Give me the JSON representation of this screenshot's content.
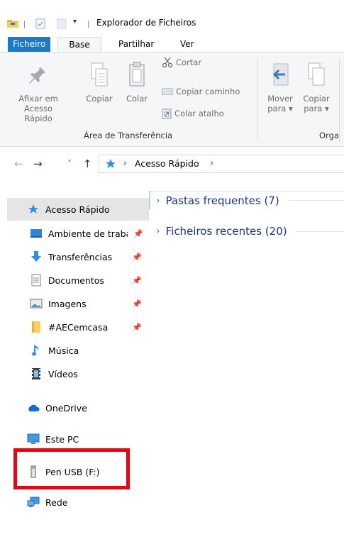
{
  "titlebar": {
    "title": "Explorador de Ficheiros",
    "dropdown_glyph": "▾"
  },
  "tabs": [
    {
      "label": "Ficheiro"
    },
    {
      "label": "Base"
    },
    {
      "label": "Partilhar"
    },
    {
      "label": "Ver"
    }
  ],
  "ribbon": {
    "pin": {
      "line1": "Afixar em",
      "line2": "Acesso Rápido"
    },
    "copy": {
      "label": "Copiar"
    },
    "paste": {
      "label": "Colar"
    },
    "cut": {
      "label": "Cortar"
    },
    "copy_path": {
      "label": "Copiar caminho"
    },
    "paste_shortcut": {
      "label": "Colar atalho"
    },
    "clipboard_group": "Área de Transferência",
    "move_to": {
      "line1": "Mover",
      "line2": "para ▾"
    },
    "copy_to": {
      "line1": "Copiar",
      "line2": "para ▾"
    },
    "organize_group": "Orga"
  },
  "address": {
    "back": "←",
    "forward": "→",
    "recent": "˅",
    "up": "↑",
    "crumb": "Acesso Rápido",
    "sep": "›"
  },
  "nav": {
    "items": [
      {
        "label": "Acesso Rápido",
        "icon": "star-icon"
      },
      {
        "label": "Ambiente de trabalho",
        "icon": "desktop-icon",
        "pinned": true
      },
      {
        "label": "Transferências",
        "icon": "download-icon",
        "pinned": true
      },
      {
        "label": "Documentos",
        "icon": "document-icon",
        "pinned": true
      },
      {
        "label": "Imagens",
        "icon": "image-icon",
        "pinned": true
      },
      {
        "label": "#AECemcasa",
        "icon": "folder-icon",
        "pinned": true
      },
      {
        "label": "Música",
        "icon": "music-icon"
      },
      {
        "label": "Vídeos",
        "icon": "video-icon"
      },
      {
        "label": "OneDrive",
        "icon": "cloud-icon"
      },
      {
        "label": "Este PC",
        "icon": "computer-icon"
      },
      {
        "label": "Pen USB (F:)",
        "icon": "usb-drive-icon"
      },
      {
        "label": "Rede",
        "icon": "network-icon"
      }
    ]
  },
  "content": {
    "sections": [
      {
        "label": "Pastas frequentes (7)"
      },
      {
        "label": "Ficheiros recentes (20)"
      }
    ]
  },
  "colors": {
    "accent": "#1979ca",
    "highlight": "#e30613",
    "section_text": "#1e3287"
  }
}
